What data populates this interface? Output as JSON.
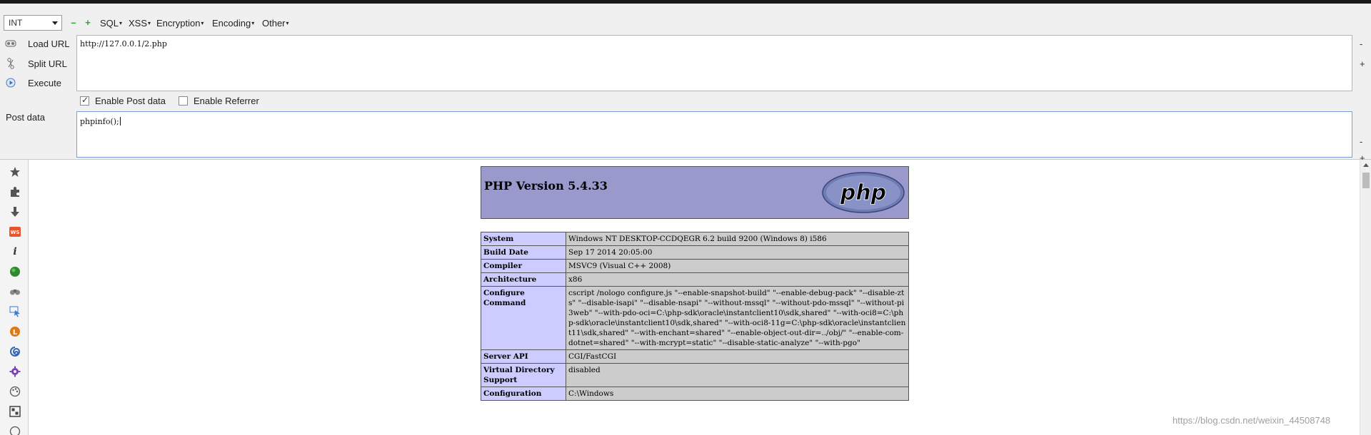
{
  "toolbar": {
    "select_value": "INT",
    "menus": [
      "SQL",
      "XSS",
      "Encryption",
      "Encoding",
      "Other"
    ]
  },
  "actions": {
    "load_url": "Load URL",
    "split_url": "Split URL",
    "execute": "Execute"
  },
  "url_value": "http://127.0.0.1/2.php",
  "checkboxes": {
    "enable_post": {
      "label": "Enable Post data",
      "checked": true
    },
    "enable_referrer": {
      "label": "Enable Referrer",
      "checked": false
    }
  },
  "post": {
    "label": "Post data",
    "value": "phpinfo();"
  },
  "side_controls": {
    "minus": "-",
    "plus": "+"
  },
  "phpinfo": {
    "title": "PHP Version 5.4.33",
    "logo_text": "php",
    "rows": [
      {
        "key": "System",
        "value": "Windows NT DESKTOP-CCDQEGR 6.2 build 9200 (Windows 8) i586"
      },
      {
        "key": "Build Date",
        "value": "Sep 17 2014 20:05:00"
      },
      {
        "key": "Compiler",
        "value": "MSVC9 (Visual C++ 2008)"
      },
      {
        "key": "Architecture",
        "value": "x86"
      },
      {
        "key": "Configure Command",
        "value": "cscript /nologo configure.js \"--enable-snapshot-build\" \"--enable-debug-pack\" \"--disable-zts\" \"--disable-isapi\" \"--disable-nsapi\" \"--without-mssql\" \"--without-pdo-mssql\" \"--without-pi3web\" \"--with-pdo-oci=C:\\php-sdk\\oracle\\instantclient10\\sdk,shared\" \"--with-oci8=C:\\php-sdk\\oracle\\instantclient10\\sdk,shared\" \"--with-oci8-11g=C:\\php-sdk\\oracle\\instantclient11\\sdk,shared\" \"--with-enchant=shared\" \"--enable-object-out-dir=../obj/\" \"--enable-com-dotnet=shared\" \"--with-mcrypt=static\" \"--disable-static-analyze\" \"--with-pgo\""
      },
      {
        "key": "Server API",
        "value": "CGI/FastCGI"
      },
      {
        "key": "Virtual Directory Support",
        "value": "disabled"
      },
      {
        "key": "Configuration",
        "value": "C:\\Windows"
      }
    ]
  },
  "watermark": "https://blog.csdn.net/weixin_44508748",
  "colors": {
    "php_header": "#9999cc",
    "php_key": "#ccccff",
    "php_value": "#cccccc",
    "toolbar_green": "#2aa52a"
  },
  "sidebar_icons": [
    "star-icon",
    "puzzle-icon",
    "download-icon",
    "ws-icon",
    "info-icon",
    "green-globe-icon",
    "binoculars-icon",
    "cursor-select-icon",
    "orange-l-icon",
    "swirl-icon",
    "gear-purple-icon",
    "palette-icon",
    "grid-icon",
    "circle-icon"
  ]
}
